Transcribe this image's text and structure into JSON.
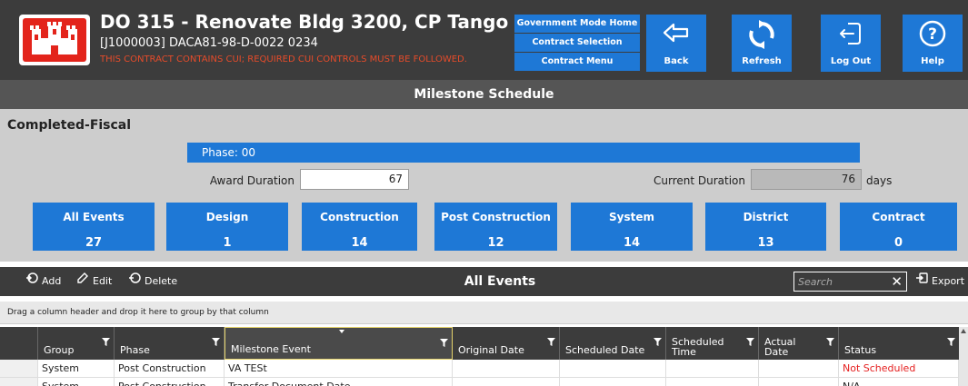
{
  "header": {
    "title": "DO 315 - Renovate Bldg 3200, CP Tango",
    "subtitle": "[J1000003] DACA81-98-D-0022  0234",
    "cui_notice": "THIS CONTRACT CONTAINS CUI; REQUIRED CUI CONTROLS MUST BE FOLLOWED.",
    "nav_links": [
      "Government Mode Home",
      "Contract Selection",
      "Contract Menu"
    ],
    "buttons": {
      "back": "Back",
      "refresh": "Refresh",
      "logout": "Log Out",
      "help": "Help"
    }
  },
  "section_title": "Milestone Schedule",
  "panel": {
    "label": "Completed-Fiscal",
    "phase": "Phase: 00",
    "award_duration_label": "Award Duration",
    "award_duration_value": "67",
    "current_duration_label": "Current Duration",
    "current_duration_value": "76",
    "days_label": "days"
  },
  "categories": [
    {
      "name": "All Events",
      "count": "27"
    },
    {
      "name": "Design",
      "count": "1"
    },
    {
      "name": "Construction",
      "count": "14"
    },
    {
      "name": "Post Construction",
      "count": "12"
    },
    {
      "name": "System",
      "count": "14"
    },
    {
      "name": "District",
      "count": "13"
    },
    {
      "name": "Contract",
      "count": "0"
    }
  ],
  "events_toolbar": {
    "add": "Add",
    "edit": "Edit",
    "delete": "Delete",
    "title": "All Events",
    "search_placeholder": "Search",
    "export": "Export"
  },
  "group_hint": "Drag a column header and drop it here to group by that column",
  "grid": {
    "columns": [
      "Group",
      "Phase",
      "Milestone Event",
      "Original Date",
      "Scheduled Date",
      "Scheduled Time",
      "Actual Date",
      "Status"
    ],
    "rows": [
      [
        "System",
        "Post Construction",
        "VA TESt",
        "",
        "",
        "",
        "",
        "Not Scheduled"
      ],
      [
        "System",
        "Post Construction",
        "Transfer Document Date",
        "",
        "",
        "",
        "",
        "N/A"
      ]
    ]
  },
  "colors": {
    "header_bg": "#3c3c3c",
    "accent_blue": "#1e78d6",
    "cui_red": "#e54b2a",
    "status_red": "#e52020",
    "panel_gray": "#cdcdcd"
  }
}
